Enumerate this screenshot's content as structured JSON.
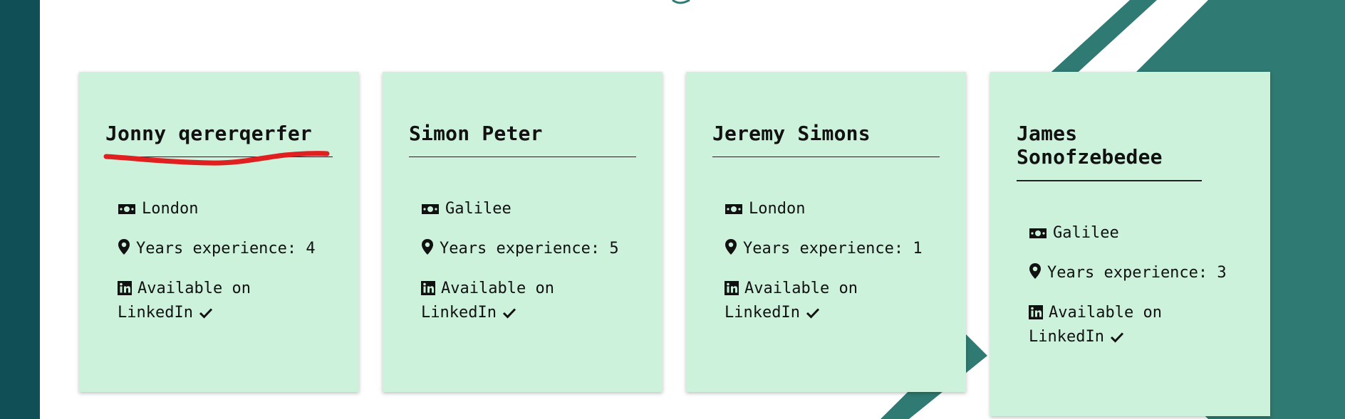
{
  "colors": {
    "page_background": "#0f4f55",
    "panel": "#ffffff",
    "card": "#cdf2dc",
    "stripe": "#2f7a72",
    "scribble": "#e02020"
  },
  "cards": [
    {
      "name": "Jonny qererqerfer",
      "location": "London",
      "experience_label": "Years experience:",
      "experience_value": "4",
      "linkedin_label": "Available on LinkedIn"
    },
    {
      "name": "Simon Peter",
      "location": "Galilee",
      "experience_label": "Years experience:",
      "experience_value": "5",
      "linkedin_label": "Available on LinkedIn"
    },
    {
      "name": "Jeremy Simons",
      "location": "London",
      "experience_label": "Years experience:",
      "experience_value": "1",
      "linkedin_label": "Available on LinkedIn"
    },
    {
      "name": "James Sonofzebedee",
      "location": "Galilee",
      "experience_label": "Years experience:",
      "experience_value": "3",
      "linkedin_label": "Available on LinkedIn"
    }
  ],
  "icons": {
    "location": "money-icon",
    "experience": "map-pin-icon",
    "linkedin": "linkedin-icon",
    "available": "check-icon"
  }
}
